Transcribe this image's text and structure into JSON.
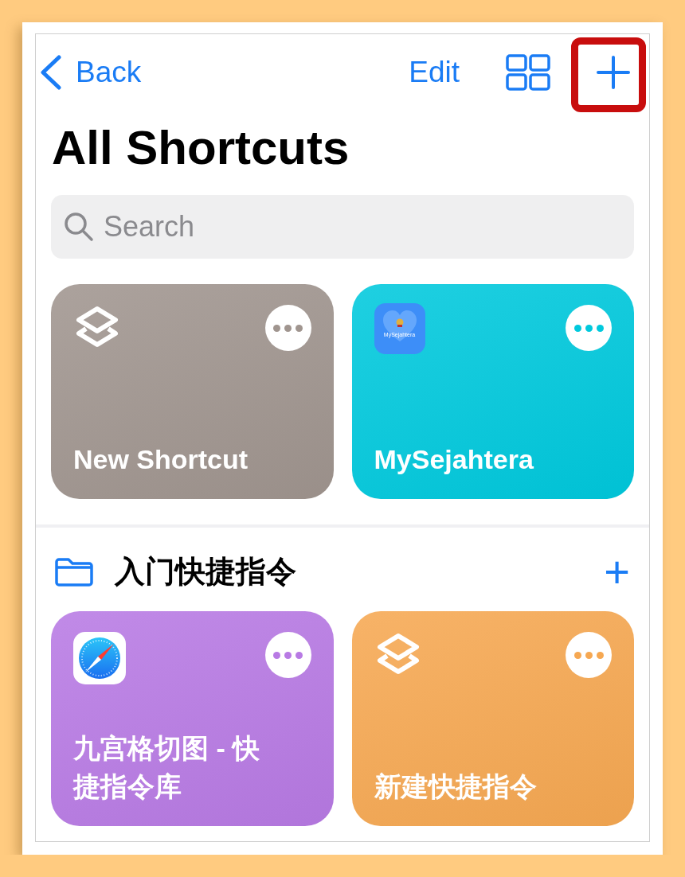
{
  "nav": {
    "back": "Back",
    "edit": "Edit",
    "add": {
      "highlighted": true
    }
  },
  "title": "All Shortcuts",
  "search": {
    "placeholder": "Search"
  },
  "shortcuts": [
    {
      "title": "New Shortcut",
      "kind": "layers",
      "color": "#a0958f"
    },
    {
      "title": "MySejahtera",
      "kind": "app",
      "icon_label": "MySejahtera",
      "color": "#00c9dd"
    }
  ],
  "folder": {
    "name": "入门快捷指令",
    "add": "+"
  },
  "folder_shortcuts": [
    {
      "title": "九宫格切图 - 快捷指令库",
      "kind": "compass",
      "color": "#b87ae4"
    },
    {
      "title": "新建快捷指令",
      "kind": "layers",
      "color": "#f6a852"
    }
  ]
}
